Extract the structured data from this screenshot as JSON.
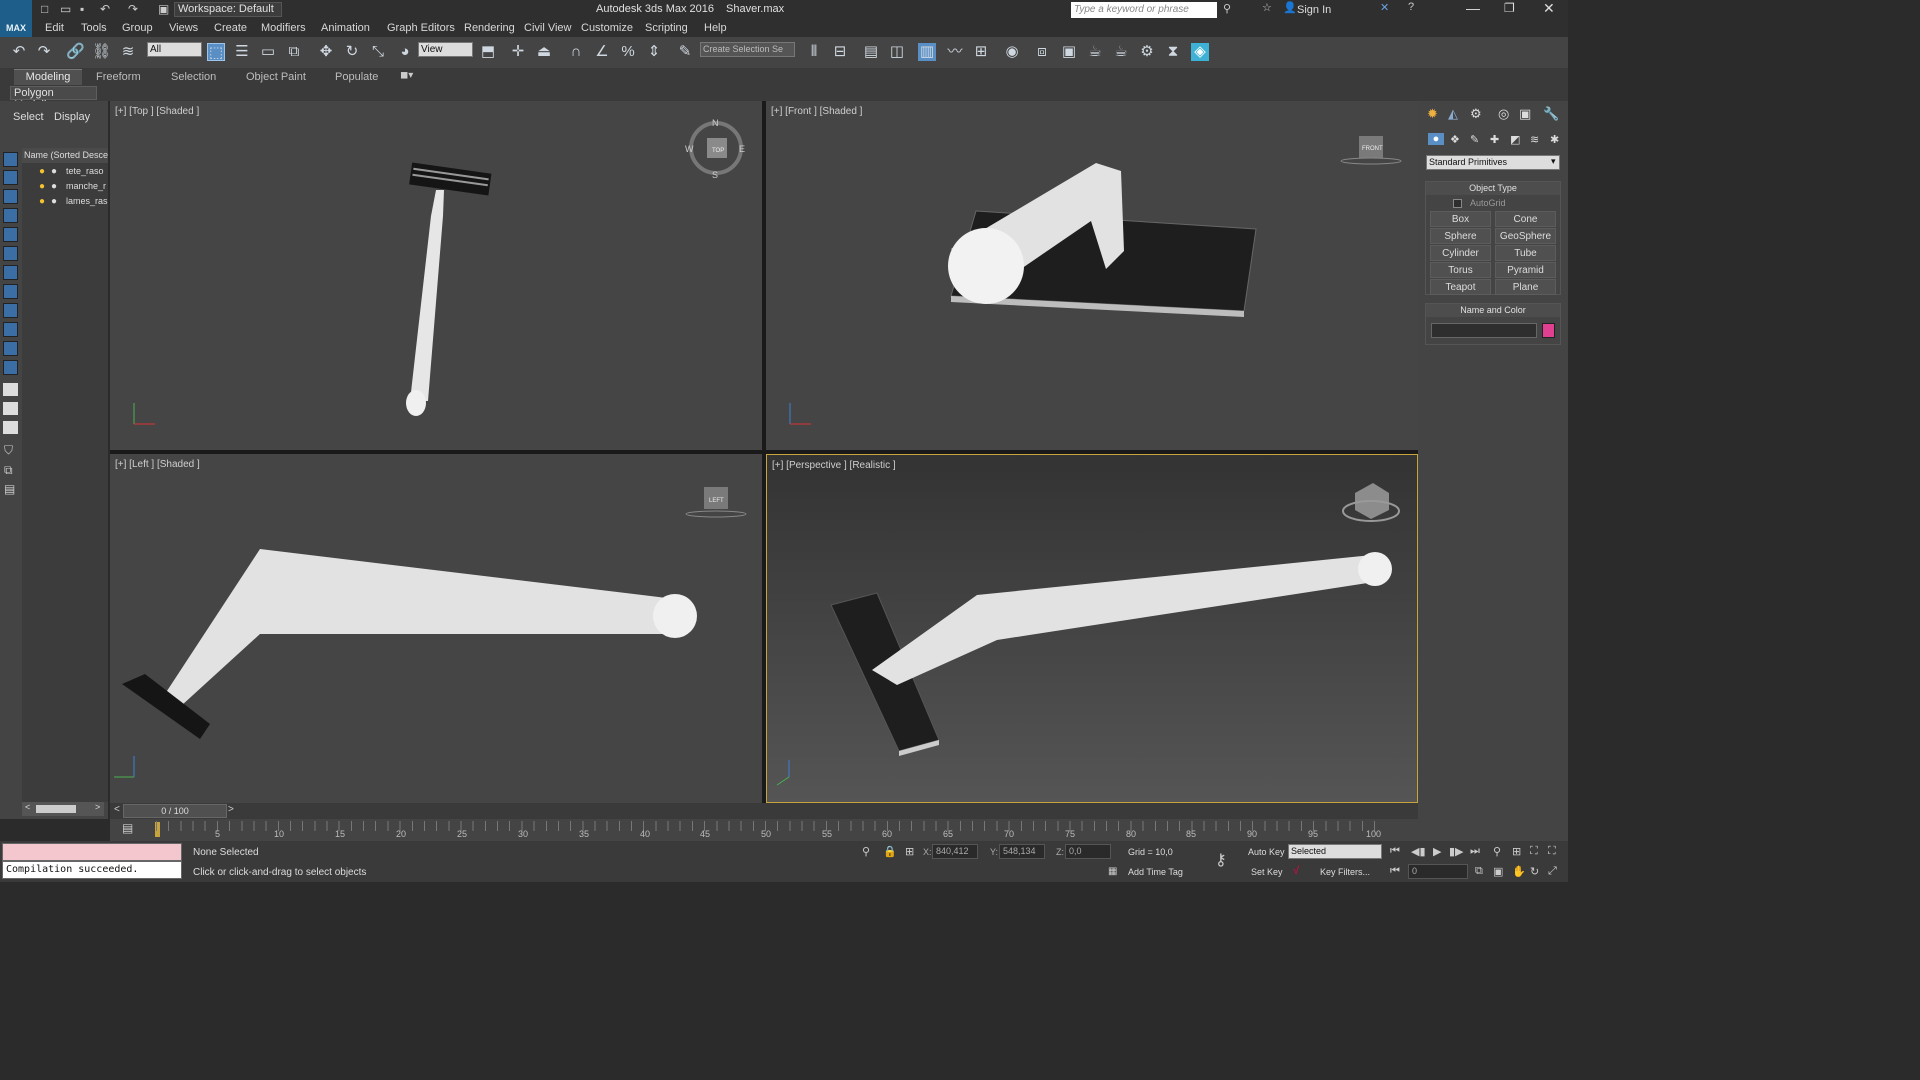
{
  "window": {
    "title": "Autodesk 3ds Max 2016",
    "file": "Shaver.max",
    "workspace": "Workspace: Default",
    "search_placeholder": "Type a keyword or phrase",
    "sign_in": "Sign In"
  },
  "menu": [
    "Edit",
    "Tools",
    "Group",
    "Views",
    "Create",
    "Modifiers",
    "Animation",
    "Graph Editors",
    "Rendering",
    "Civil View",
    "Customize",
    "Scripting",
    "Help"
  ],
  "toolbar": {
    "filter": "All",
    "ref_coord": "View",
    "selection_set": "Create Selection Se"
  },
  "ribbon": {
    "tabs": [
      "Modeling",
      "Freeform",
      "Selection",
      "Object Paint",
      "Populate"
    ],
    "panel": "Polygon Modeling"
  },
  "scene_explorer": {
    "tabs": [
      "Select",
      "Display"
    ],
    "header": "Name (Sorted Descen",
    "objects": [
      "tete_raso",
      "manche_r",
      "lames_ras"
    ]
  },
  "viewports": {
    "top": "[+] [Top ] [Shaded ]",
    "front": "[+] [Front ] [Shaded ]",
    "left": "[+] [Left ] [Shaded ]",
    "perspective": "[+] [Perspective ] [Realistic ]",
    "top_cube": "TOP",
    "front_cube": "FRONT",
    "left_cube": "LEFT",
    "compass": {
      "n": "N",
      "s": "S",
      "e": "E",
      "w": "W"
    }
  },
  "command_panel": {
    "dropdown": "Standard Primitives",
    "object_type_title": "Object Type",
    "autogrid": "AutoGrid",
    "primitives": [
      "Box",
      "Cone",
      "Sphere",
      "GeoSphere",
      "Cylinder",
      "Tube",
      "Torus",
      "Pyramid",
      "Teapot",
      "Plane"
    ],
    "name_color_title": "Name and Color",
    "color": "#e0408f"
  },
  "timeline": {
    "frame": "0 / 100",
    "ticks": [
      "0",
      "5",
      "10",
      "15",
      "20",
      "25",
      "30",
      "35",
      "40",
      "45",
      "50",
      "55",
      "60",
      "65",
      "70",
      "75",
      "80",
      "85",
      "90",
      "95",
      "100"
    ]
  },
  "status": {
    "listener": "Compilation succeeded.",
    "selection": "None Selected",
    "prompt": "Click or click-and-drag to select objects",
    "x_label": "X:",
    "x": "840,412",
    "y_label": "Y:",
    "y": "548,134",
    "z_label": "Z:",
    "z": "0,0",
    "grid": "Grid = 10,0",
    "add_time_tag": "Add Time Tag",
    "auto_key": "Auto Key",
    "set_key": "Set Key",
    "key_mode": "Selected",
    "key_filters": "Key Filters...",
    "current_frame": "0"
  }
}
